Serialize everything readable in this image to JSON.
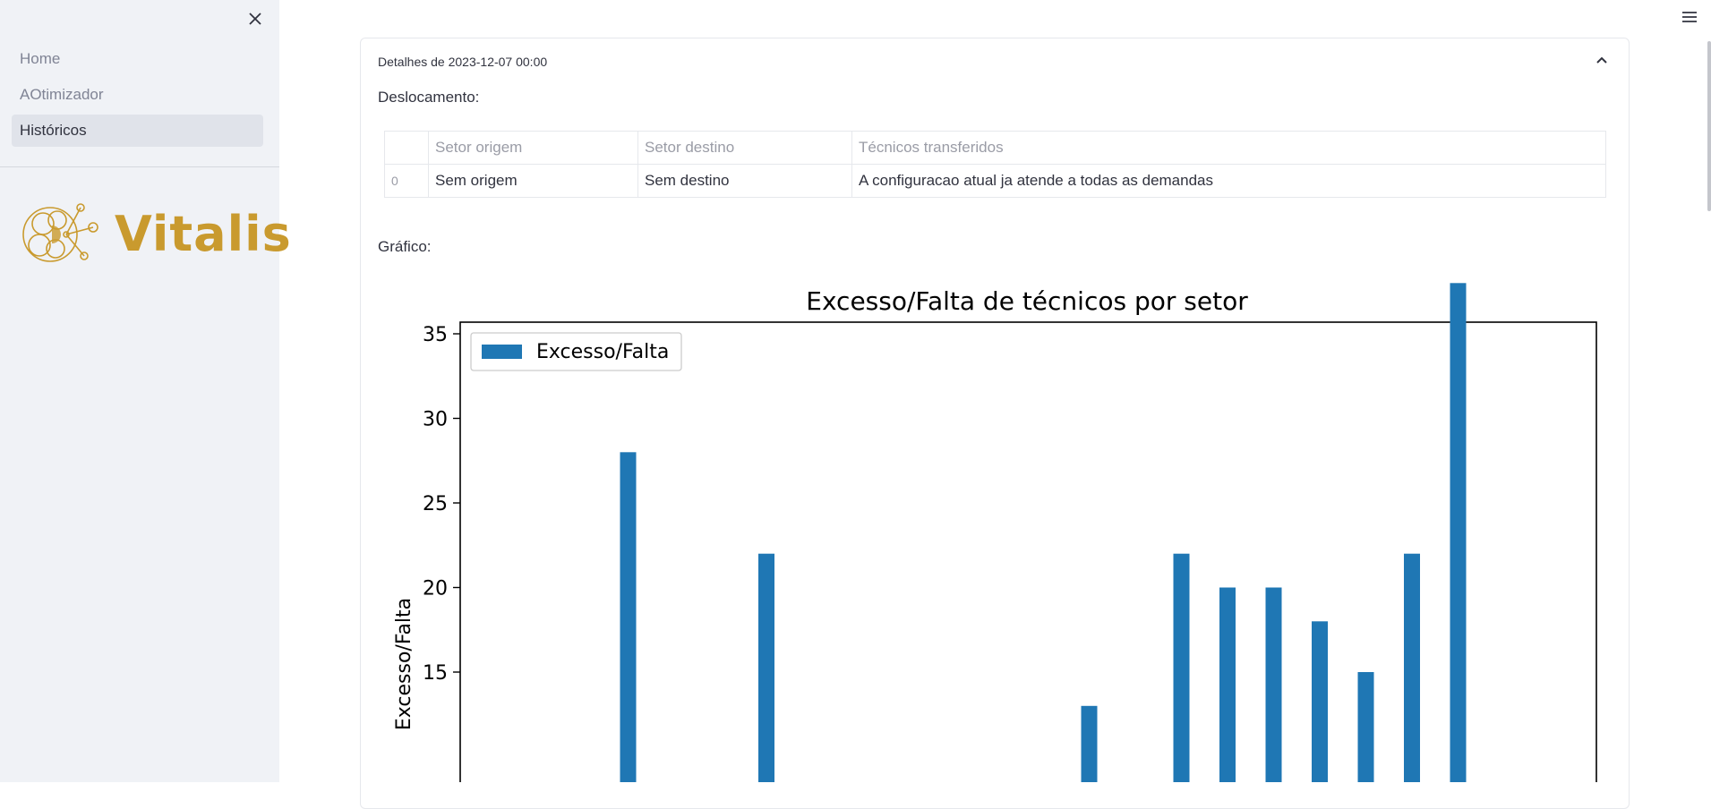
{
  "sidebar": {
    "nav": [
      {
        "label": "Home",
        "active": false
      },
      {
        "label": "AOtimizador",
        "active": false
      },
      {
        "label": "Históricos",
        "active": true
      }
    ],
    "logo_text": "Vitalis"
  },
  "expander": {
    "title": "Detalhes de 2023-12-07 00:00",
    "deslocamento_label": "Deslocamento:",
    "grafico_label": "Gráfico:"
  },
  "table": {
    "columns": [
      "",
      "Setor origem",
      "Setor destino",
      "Técnicos transferidos"
    ],
    "rows": [
      {
        "index": "0",
        "origem": "Sem origem",
        "destino": "Sem destino",
        "tecnicos": "A configuracao atual ja atende a todas as demandas"
      }
    ]
  },
  "colors": {
    "bar": "#1f77b4",
    "logo": "#c99a2e",
    "sidebar_bg": "#f0f2f6"
  },
  "icons": [
    "close-icon",
    "hamburger-menu-icon",
    "chevron-up-icon",
    "vitalis-logo"
  ],
  "chart_data": {
    "type": "bar",
    "title": "Excesso/Falta de técnicos por setor",
    "ylabel": "Excesso/Falta",
    "xlabel": "",
    "legend": "top-left",
    "series": [
      {
        "name": "Excesso/Falta",
        "values": [
          28,
          22,
          13,
          22,
          20,
          20,
          18,
          15,
          22,
          38
        ]
      }
    ],
    "bar_slots": [
      3,
      6,
      13,
      15,
      16,
      17,
      18,
      19,
      20,
      21
    ],
    "total_slots": 25,
    "yticks": [
      15,
      20,
      25,
      30,
      35
    ],
    "ylim_top": 40
  }
}
